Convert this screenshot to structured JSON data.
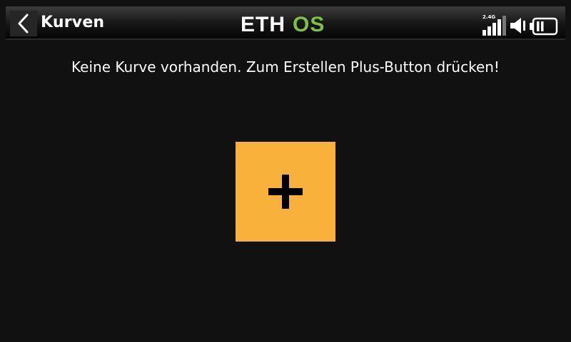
{
  "header": {
    "title": "Kurven",
    "logo_text_white": "ETH",
    "logo_text_green": "OS",
    "rf_band": "2.4G"
  },
  "main": {
    "empty_message": "Keine Kurve vorhanden. Zum Erstellen Plus-Button drücken!",
    "add_button_icon": "plus-icon"
  },
  "icons": {
    "back": "chevron-left-icon",
    "signal": "signal-strength-icon",
    "volume": "speaker-icon",
    "battery": "battery-icon"
  },
  "colors": {
    "background": "#111111",
    "accent": "#f8b13a",
    "logo_green": "#7dc242"
  }
}
